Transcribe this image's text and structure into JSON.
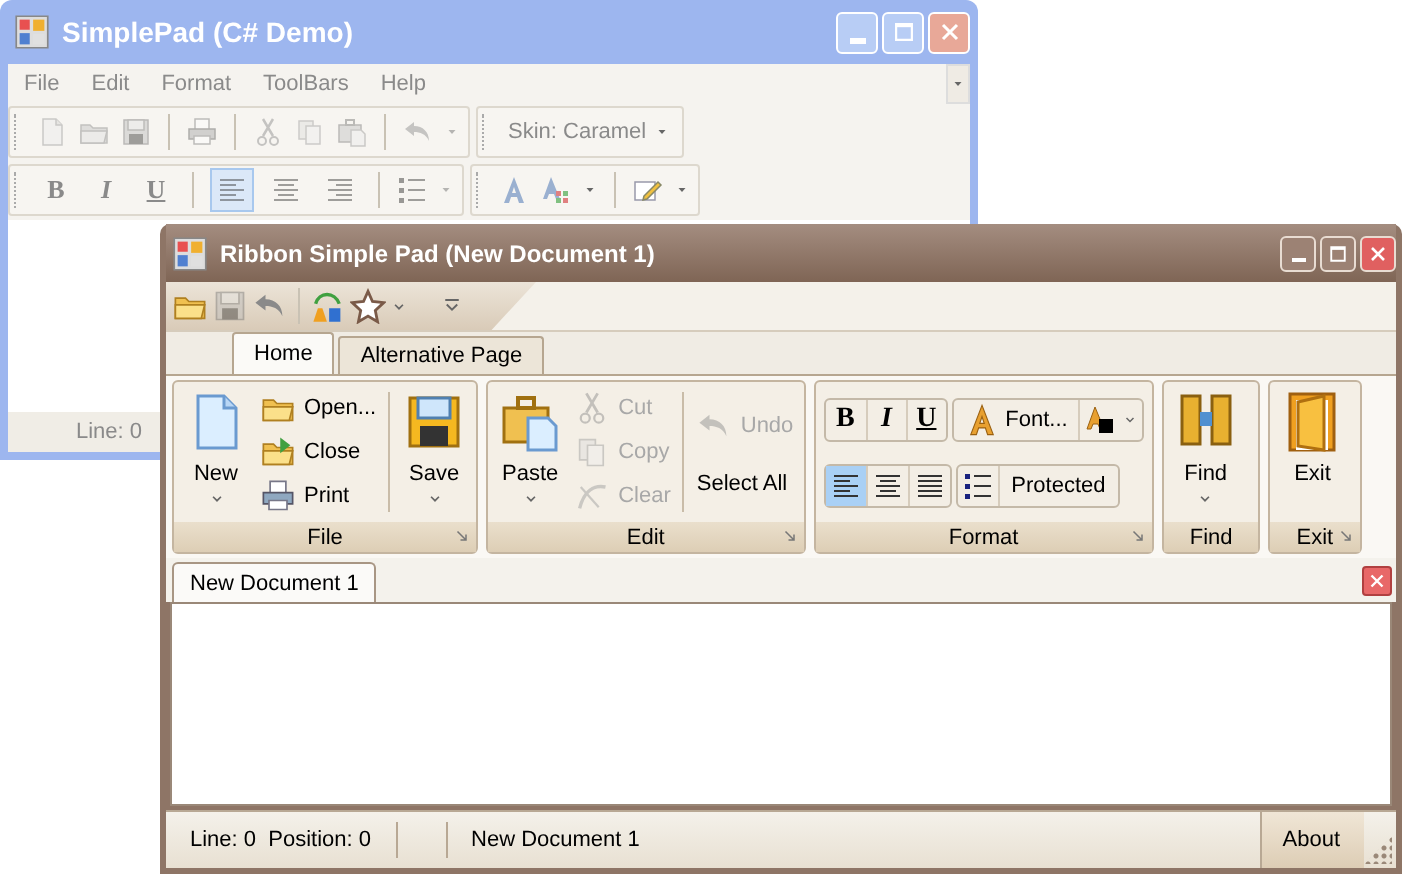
{
  "back_window": {
    "title": "SimplePad (C# Demo)",
    "menu": [
      "File",
      "Edit",
      "Format",
      "ToolBars",
      "Help"
    ],
    "skin_combo": "Skin: Caramel",
    "style_buttons": [
      {
        "label": "B"
      },
      {
        "label": "I"
      },
      {
        "label": "U"
      }
    ],
    "align_buttons": [
      {
        "selected": true
      },
      {
        "selected": false
      },
      {
        "selected": false
      }
    ],
    "status": "Line: 0"
  },
  "front_window": {
    "title": "Ribbon Simple Pad (New Document 1)",
    "tabs": [
      {
        "label": "Home",
        "selected": true
      },
      {
        "label": "Alternative Page",
        "selected": false
      }
    ],
    "groups": [
      {
        "caption": "File",
        "kind": "buttons",
        "launcher": true,
        "columns": [
          {
            "kind": "large",
            "label": "New",
            "dropdown": true,
            "disabled": false
          },
          {
            "kind": "stack",
            "items": [
              {
                "label": "Open...",
                "disabled": false
              },
              {
                "label": "Close",
                "disabled": false
              },
              {
                "label": "Print",
                "disabled": false
              }
            ]
          },
          {
            "kind": "separator"
          },
          {
            "kind": "large",
            "label": "Save",
            "dropdown": true,
            "disabled": false
          }
        ]
      },
      {
        "caption": "Edit",
        "kind": "buttons",
        "launcher": true,
        "columns": [
          {
            "kind": "large",
            "label": "Paste",
            "dropdown": true,
            "disabled": false
          },
          {
            "kind": "stack",
            "items": [
              {
                "label": "Cut",
                "disabled": true
              },
              {
                "label": "Copy",
                "disabled": true
              },
              {
                "label": "Clear",
                "disabled": true
              }
            ]
          },
          {
            "kind": "separator"
          },
          {
            "kind": "stack",
            "items": [
              {
                "label": "Undo",
                "disabled": true
              },
              {
                "label": "Select All",
                "disabled": false
              }
            ]
          }
        ]
      },
      {
        "caption": "Format",
        "kind": "format",
        "launcher": true,
        "style_buttons": [
          {
            "label": "B",
            "selected": false
          },
          {
            "label": "I",
            "selected": false
          },
          {
            "label": "U",
            "selected": false
          }
        ],
        "font_button": "Font...",
        "align_buttons": [
          {
            "selected": true
          },
          {
            "selected": false
          },
          {
            "selected": false
          }
        ],
        "protected_button": "Protected"
      },
      {
        "caption": "Find",
        "kind": "buttons",
        "launcher": false,
        "columns": [
          {
            "kind": "large",
            "label": "Find",
            "dropdown": true,
            "disabled": false
          }
        ]
      },
      {
        "caption": "Exit",
        "kind": "buttons",
        "launcher": true,
        "columns": [
          {
            "kind": "large",
            "label": "Exit",
            "dropdown": false,
            "disabled": false
          }
        ]
      }
    ],
    "document_tabs": [
      {
        "label": "New Document 1",
        "selected": true
      }
    ],
    "status_bar": {
      "position": "Line: 0  Position: 0",
      "document": "New Document 1",
      "about": "About"
    }
  }
}
